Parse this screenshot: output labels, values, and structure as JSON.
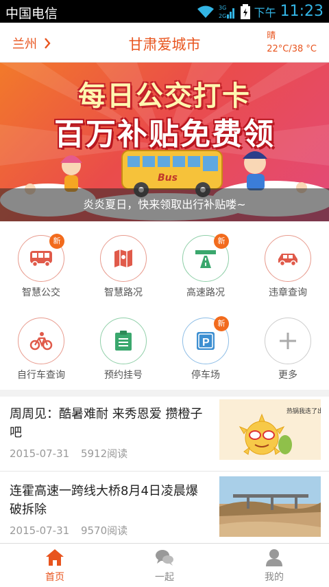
{
  "status_bar": {
    "carrier": "中国电信",
    "network_labels": [
      "3G",
      "2G"
    ],
    "ampm": "下午",
    "time": "11:23"
  },
  "header": {
    "city": "兰州",
    "title": "甘肃爱城市",
    "weather": {
      "condition": "晴",
      "temperature": "22°C/38 °C"
    }
  },
  "banner": {
    "headline_1": "每日公交打卡",
    "headline_2": "百万补贴免费领",
    "bus_label": "Bus",
    "caption": "炎炎夏日，快来领取出行补贴喽~"
  },
  "services": [
    {
      "label": "智慧公交",
      "icon": "bus-icon",
      "badge": "新",
      "color": "#e05a4a"
    },
    {
      "label": "智慧路况",
      "icon": "map-icon",
      "badge": "",
      "color": "#e05a4a"
    },
    {
      "label": "高速路况",
      "icon": "highway-icon",
      "badge": "新",
      "color": "#3aa76d"
    },
    {
      "label": "违章查询",
      "icon": "car-icon",
      "badge": "",
      "color": "#e05a4a"
    },
    {
      "label": "自行车查询",
      "icon": "bicycle-icon",
      "badge": "",
      "color": "#e05a4a"
    },
    {
      "label": "预约挂号",
      "icon": "clipboard-icon",
      "badge": "",
      "color": "#3aa76d"
    },
    {
      "label": "停车场",
      "icon": "parking-icon",
      "badge": "新",
      "color": "#3d8fd1"
    },
    {
      "label": "更多",
      "icon": "plus-icon",
      "badge": "",
      "color": "#aaaaaa"
    }
  ],
  "news": [
    {
      "title": "周周见：酷暑难耐 来秀恩爱 攒橙子吧",
      "date": "2015-07-31",
      "reads": "5912阅读",
      "thumb_note": "热锅我迭了出！"
    },
    {
      "title": "连霍高速一跨线大桥8月4日凌晨爆破拆除",
      "date": "2015-07-31",
      "reads": "9570阅读",
      "thumb_note": ""
    }
  ],
  "bottom_nav": [
    {
      "label": "首页",
      "icon": "home-icon",
      "active": true
    },
    {
      "label": "一起",
      "icon": "chat-icon",
      "active": false
    },
    {
      "label": "我的",
      "icon": "person-icon",
      "active": false
    }
  ],
  "colors": {
    "accent": "#e8541e",
    "badge": "#f26b1d",
    "status_blue": "#33b5e5"
  }
}
